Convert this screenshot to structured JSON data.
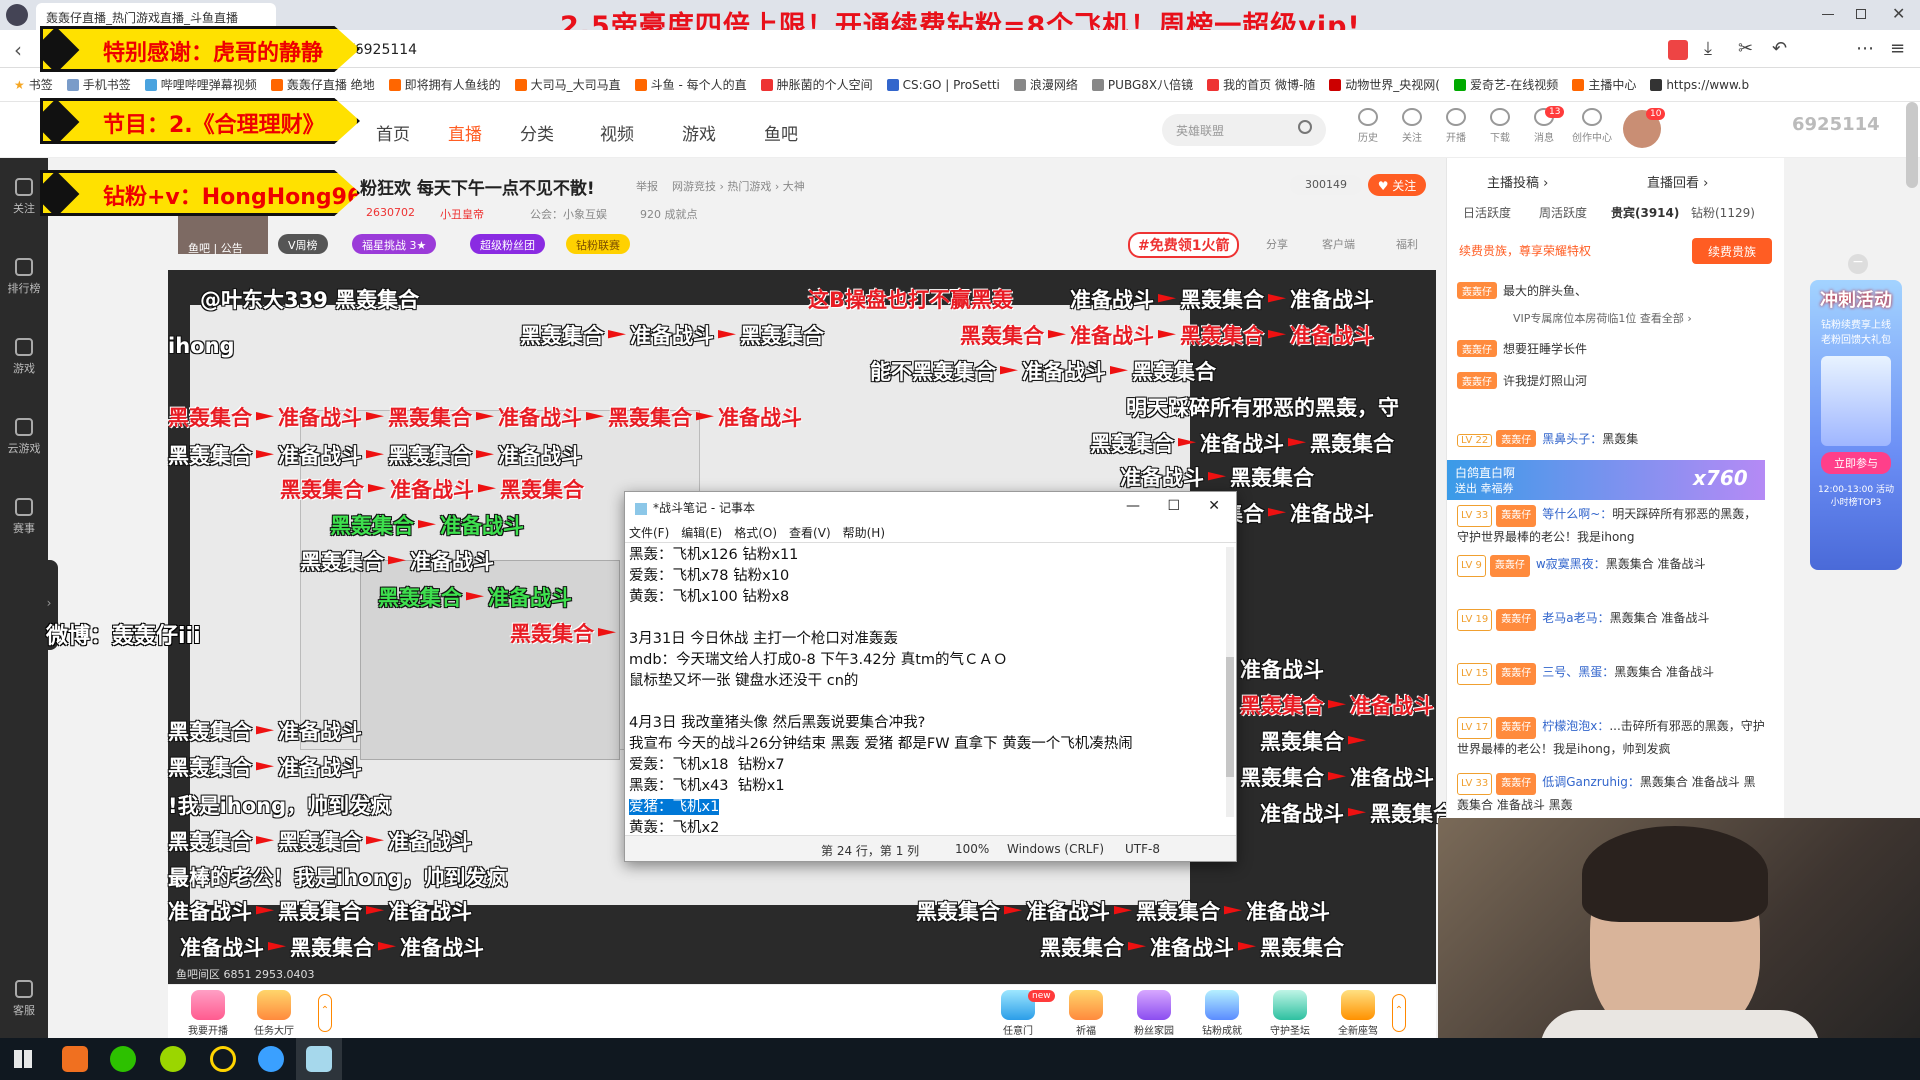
{
  "browser": {
    "tab_title": "轰轰仔直播_热门游戏直播_斗鱼直播",
    "url": "/6925114",
    "bookmarks": [
      "书签",
      "手机书签",
      "哔哩哔哩弹幕视频",
      "轰轰仔直播 绝地",
      "即将拥有人鱼线的",
      "大司马_大司马直",
      "斗鱼 - 每个人的直",
      "肿胀菌的个人空间",
      "CS:GO | ProSetti",
      "浪漫网络",
      "PUBG8X八倍镜",
      "我的首页 微博-随",
      "动物世界_央视网(",
      "爱奇艺-在线视频",
      "主播中心",
      "https://www.b"
    ]
  },
  "overlay": {
    "promo_text": "2.5帝豪度四倍上限！开通续费钻粉=8个飞机！周榜一超级vip!",
    "thanks_label": "特别感谢：虎哥的静静",
    "program_label": "节目：2.《合理理财》",
    "wechat_label": "钻粉+v：HongHong9654",
    "weibo_label": "微博：轰轰仔iii"
  },
  "header": {
    "nav": [
      "首页",
      "直播",
      "分类",
      "视频",
      "游戏",
      "鱼吧"
    ],
    "search_placeholder": "英雄联盟",
    "tools": [
      "历史",
      "关注",
      "开播",
      "下载",
      "消息",
      "创作中心"
    ],
    "message_count": "13",
    "avatar_badge": "10",
    "room_id": "6925114"
  },
  "sidebar": [
    "关注",
    "排行榜",
    "游戏",
    "云游戏",
    "赛事",
    "客服"
  ],
  "room": {
    "title": "粉狂欢 每天下午一点不见不散!",
    "report": "举报",
    "category": "网游竞技 › 热门游戏 › 大神",
    "hot": "2630702",
    "streamer_tag": "小丑皇帝",
    "guild": "公会：小象互娱",
    "achievements": "920 成就点",
    "fans_count": "300149",
    "follow_label": "关注",
    "fishbar": "鱼吧",
    "notice": "公告",
    "pills": [
      "V周榜",
      "福星挑战 3★",
      "超级粉丝团",
      "钻粉联赛"
    ],
    "free_rocket": "#免费领1火箭",
    "actions": [
      "分享",
      "客户端",
      "福利"
    ]
  },
  "notepad": {
    "title": "*战斗笔记 - 记事本",
    "menu": [
      "文件(F)",
      "编辑(E)",
      "格式(O)",
      "查看(V)",
      "帮助(H)"
    ],
    "lines": [
      "黑轰：飞机x126 钻粉x11",
      "爱轰：飞机x78 钻粉x10",
      "黄轰：飞机x100 钻粉x8",
      "",
      "3月31日 今日休战 主打一个枪口对准轰轰",
      "mdb：今天瑞文给人打成0-8 下午3.42分 真tm的气ＣＡＯ",
      "鼠标垫又坏一张 键盘水还没干 cn的",
      "",
      "4月3日 我改童猪头像 然后黑轰说要集合冲我?",
      "我宣布 今天的战斗26分钟结束 黑轰 爱猪 都是FW 直拿下 黄轰一个飞机凑热闹",
      "爱轰：飞机x18  钻粉x7",
      "黑轰：飞机x43  钻粉x1",
      "爱猪：飞机x1",
      "黄轰：飞机x2"
    ],
    "selected_line": "爱猪：飞机x1",
    "status_pos": "第 24 行，第 1 列",
    "status_zoom": "100%",
    "status_eol": "Windows (CRLF)",
    "status_enc": "UTF-8"
  },
  "danmaku": {
    "a": "黑轰集合",
    "b": "准备战斗",
    "c": "能不黑轰集合",
    "d": "明天踩碎所有邪恶的黑轰，守",
    "e": "这B操盘也打不赢黑轰",
    "f": "!我是ihong，帅到发疯",
    "g": "最棒的老公！我是ihong，帅到发疯",
    "h": "ihong",
    "i": "《合理理财》",
    "j": "@叶东大339",
    "k": "是ihong，帅到发疯"
  },
  "right_panel": {
    "tabs_top": [
      "主播投稿 ›",
      "直播回看 ›"
    ],
    "tabs": [
      "日活跃度",
      "周活跃度",
      "贵宾(3914)",
      "钻粉(1129)"
    ],
    "renew_hint": "续费贵族，尊享荣耀特权",
    "renew_btn": "续费贵族",
    "vip_line": "VIP专属席位本房荷临1位 查看全部 ›",
    "gift_banner_name": "白鸽直白啊",
    "gift_banner_sub": "送出  幸福券",
    "gift_banner_count": "x760",
    "chats": [
      {
        "badge": "轰轰仔",
        "name": "",
        "text": "最大的胖头鱼、"
      },
      {
        "badge": "轰轰仔",
        "name": "",
        "text": "想要狂睡学长件"
      },
      {
        "badge": "轰轰仔",
        "name": "",
        "text": "许我提灯照山河"
      },
      {
        "lv": "LV 22",
        "badge": "轰轰仔",
        "name": "黑鼻头子：",
        "text": "黑轰集"
      },
      {
        "lv": "LV 33",
        "badge": "轰轰仔",
        "name": "等什么啊~：",
        "text": "明天踩碎所有邪恶的黑轰，守护世界最棒的老公！我是ihong"
      },
      {
        "lv": "LV 9",
        "badge": "轰轰仔",
        "name": "w寂寞黑夜：",
        "text": "黑轰集合 准备战斗"
      },
      {
        "lv": "LV 19",
        "badge": "轰轰仔",
        "name": "老马a老马：",
        "text": "黑轰集合 准备战斗"
      },
      {
        "lv": "LV 15",
        "badge": "轰轰仔",
        "name": "三号、黑蛋：",
        "text": "黑轰集合 准备战斗"
      },
      {
        "lv": "LV 17",
        "badge": "轰轰仔",
        "name": "柠檬泡泡x：",
        "text": "...击碎所有邪恶的黑轰，守护世界最棒的老公！我是ihong，帅到发疯"
      },
      {
        "lv": "LV 33",
        "badge": "轰轰仔",
        "name": "低调Ganzruhig：",
        "text": "黑轰集合 准备战斗 黑轰集合 准备战斗 黑轰"
      }
    ],
    "side_ad_title": "冲刺活动",
    "side_ad_sub": "钻粉续费享上线 老粉回馈大礼包",
    "side_ad_btn": "立即参与",
    "side_ad_time": "12:00-13:00 活动小时榜TOP3"
  },
  "giftbar": {
    "left": [
      "我要开播",
      "任务大厅"
    ],
    "right": [
      "任意门",
      "祈福",
      "粉丝家园",
      "钻粉成就",
      "守护圣坛",
      "全新座驾"
    ],
    "new_badge": "new"
  },
  "player_footer": "鱼吧间区  6851  2953.0403"
}
